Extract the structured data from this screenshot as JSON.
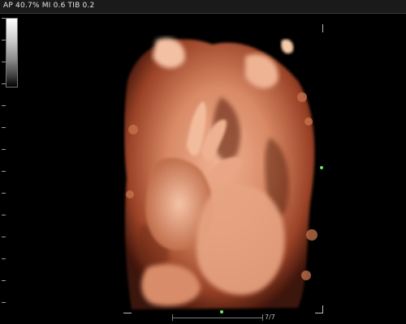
{
  "status_bar": {
    "acoustic_readout": "AP 40.7%  MI 0.6  TIB 0.2"
  },
  "grayscale_bar": {
    "icon": "grayscale-map-icon"
  },
  "render_view": {
    "subject": "3D ultrasound surface rendering",
    "palette": {
      "skin": "#e39c7a",
      "shadow": "#6a2a16",
      "background": "#000000"
    },
    "markers": {
      "color": "#6fe46f"
    }
  },
  "depth_scale": {
    "label": "7/7"
  }
}
